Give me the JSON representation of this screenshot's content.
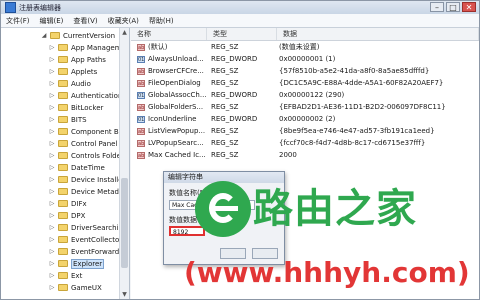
{
  "window": {
    "title": "注册表编辑器",
    "min": "–",
    "max": "□",
    "close": "✕"
  },
  "menu": [
    "文件(F)",
    "编辑(E)",
    "查看(V)",
    "收藏夹(A)",
    "帮助(H)"
  ],
  "tree": {
    "items": [
      {
        "label": "CurrentVersion",
        "expanded": true
      },
      {
        "label": "App Manageme"
      },
      {
        "label": "App Paths"
      },
      {
        "label": "Applets"
      },
      {
        "label": "Audio"
      },
      {
        "label": "Authentication"
      },
      {
        "label": "BitLocker"
      },
      {
        "label": "BITS"
      },
      {
        "label": "Component Bas"
      },
      {
        "label": "Control Panel"
      },
      {
        "label": "Controls Folder"
      },
      {
        "label": "DateTime"
      },
      {
        "label": "Device Installer"
      },
      {
        "label": "Device Metadat"
      },
      {
        "label": "DIFx"
      },
      {
        "label": "DPX"
      },
      {
        "label": "DriverSearching"
      },
      {
        "label": "EventCollector"
      },
      {
        "label": "EventForwarding"
      },
      {
        "label": "Explorer",
        "selected": true
      },
      {
        "label": "Ext"
      },
      {
        "label": "GameUX"
      }
    ]
  },
  "list": {
    "headers": [
      "名称",
      "类型",
      "数据"
    ],
    "rows": [
      {
        "name": "(默认)",
        "type": "REG_SZ",
        "data": "(数值未设置)",
        "kind": "sz"
      },
      {
        "name": "AlwaysUnload...",
        "type": "REG_DWORD",
        "data": "0x00000001 (1)",
        "kind": "bin"
      },
      {
        "name": "BrowserCFCre...",
        "type": "REG_SZ",
        "data": "{57f8510b-a5e2-41da-a8f0-8a5ae85dfffd}",
        "kind": "sz"
      },
      {
        "name": "FileOpenDialog",
        "type": "REG_SZ",
        "data": "{DC1C5A9C-E88A-4dde-A5A1-60F82A20AEF7}",
        "kind": "sz"
      },
      {
        "name": "GlobalAssocCh...",
        "type": "REG_DWORD",
        "data": "0x00000122 (290)",
        "kind": "bin"
      },
      {
        "name": "GlobalFolderS...",
        "type": "REG_SZ",
        "data": "{EFBAD2D1-AE36-11D1-B2D2-006097DF8C11}",
        "kind": "sz"
      },
      {
        "name": "IconUnderline",
        "type": "REG_DWORD",
        "data": "0x00000002 (2)",
        "kind": "bin"
      },
      {
        "name": "ListViewPopup...",
        "type": "REG_SZ",
        "data": "{8be9f5ea-e746-4e47-ad57-3fb191ca1eed}",
        "kind": "sz"
      },
      {
        "name": "LVPopupSearc...",
        "type": "REG_SZ",
        "data": "{fccf70c8-f4d7-4d8b-8c17-cd6715e37fff}",
        "kind": "sz"
      },
      {
        "name": "Max Cached Ic...",
        "type": "REG_SZ",
        "data": "2000",
        "kind": "sz"
      }
    ]
  },
  "dialog": {
    "title": "编辑字符串",
    "name_label": "数值名称(N):",
    "name_value": "Max Cached",
    "data_label": "数值数据(V):",
    "data_value": "8192"
  },
  "watermark": {
    "brand": "路由之家",
    "url": "(www.hhhyh.com)"
  }
}
